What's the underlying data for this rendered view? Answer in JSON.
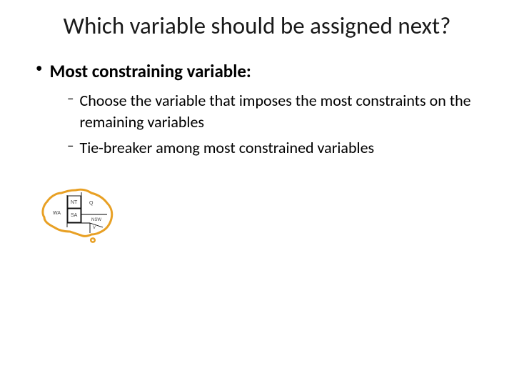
{
  "slide": {
    "title": "Which variable should be assigned next?",
    "bullet_main": "Most constraining variable:",
    "sub1": "Choose the variable that imposes the most constraints on the remaining variables",
    "sub2": "Tie-breaker among most constrained variables",
    "map": {
      "regions": {
        "wa": "WA",
        "nt": "NT",
        "q": "Q",
        "sa": "SA",
        "nsw": "NSW",
        "v": "V"
      }
    }
  }
}
